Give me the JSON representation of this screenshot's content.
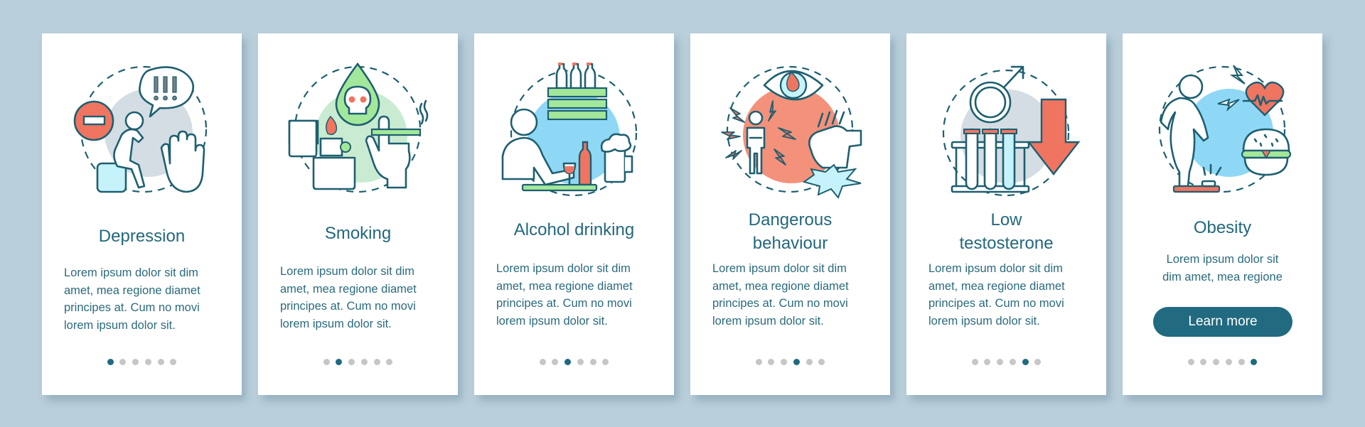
{
  "colors": {
    "background": "#b9cfdb",
    "card": "#ffffff",
    "text": "#22687d",
    "accent": "#216a80",
    "dot_inactive": "#c6c6c6",
    "icon_stroke": "#1e5f70",
    "red": "#f07561",
    "green": "#a3e89a",
    "blue": "#8fd8f5",
    "grey_blob": "#d3dde3"
  },
  "pagination": {
    "total_pages": 6
  },
  "cards": [
    {
      "icon": "depression-icon",
      "title_lines": [
        "Depression"
      ],
      "body_lines": [
        "Lorem ipsum dolor sit dim",
        "amet, mea regione diamet",
        "principes at. Cum no movi",
        "lorem ipsum dolor sit."
      ],
      "active_page": 1
    },
    {
      "icon": "smoking-icon",
      "title_lines": [
        "Smoking"
      ],
      "body_lines": [
        "Lorem ipsum dolor sit dim",
        "amet, mea regione diamet",
        "principes at. Cum no movi",
        "lorem ipsum dolor sit."
      ],
      "active_page": 2
    },
    {
      "icon": "alcohol-drinking-icon",
      "title_lines": [
        "Alcohol drinking"
      ],
      "body_lines": [
        "Lorem ipsum dolor sit dim",
        "amet, mea regione diamet",
        "principes at. Cum no movi",
        "lorem ipsum dolor sit."
      ],
      "active_page": 3
    },
    {
      "icon": "dangerous-behaviour-icon",
      "title_lines": [
        "Dangerous",
        "behaviour"
      ],
      "body_lines": [
        "Lorem ipsum dolor sit dim",
        "amet, mea regione diamet",
        "principes at. Cum no movi",
        "lorem ipsum dolor sit."
      ],
      "active_page": 4
    },
    {
      "icon": "low-testosterone-icon",
      "title_lines": [
        "Low",
        "testosterone"
      ],
      "body_lines": [
        "Lorem ipsum dolor sit dim",
        "amet, mea regione diamet",
        "principes at. Cum no movi",
        "lorem ipsum dolor sit."
      ],
      "active_page": 5
    },
    {
      "icon": "obesity-icon",
      "title_lines": [
        "Obesity"
      ],
      "body_lines": [
        "Lorem ipsum dolor sit",
        "dim amet, mea regione"
      ],
      "button_label": "Learn more",
      "active_page": 6
    }
  ]
}
